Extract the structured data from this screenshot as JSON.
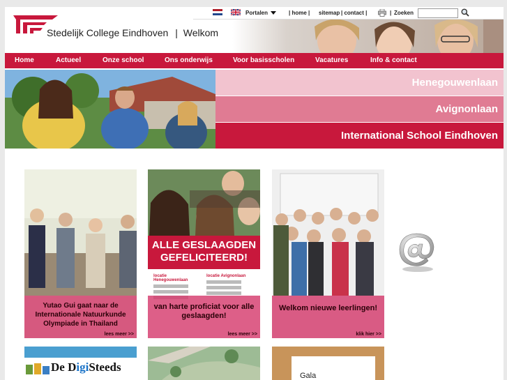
{
  "header": {
    "school_name": "Stedelijk College Eindhoven",
    "separator": "|",
    "welcome": "Welkom"
  },
  "util": {
    "portalen": "Portalen",
    "links": [
      {
        "label": "| home |"
      },
      {
        "label": "sitemap"
      },
      {
        "label": "| contact |"
      },
      {
        "label": "|"
      }
    ],
    "search_label": "Zoeken",
    "search_placeholder": ""
  },
  "nav": {
    "items": [
      {
        "label": "Home"
      },
      {
        "label": "Actueel"
      },
      {
        "label": "Onze school"
      },
      {
        "label": "Ons onderwijs"
      },
      {
        "label": "Voor basisscholen"
      },
      {
        "label": "Vacatures"
      },
      {
        "label": "Info & contact"
      }
    ]
  },
  "locations": [
    {
      "label": "Henegouwenlaan"
    },
    {
      "label": "Avignonlaan"
    },
    {
      "label": "International School Eindhoven"
    }
  ],
  "tiles": [
    {
      "caption": "Yutao Gui gaat naar de Internationale Natuurkunde Olympiade in Thailand",
      "more": "lees meer >>"
    },
    {
      "headline": "ALLE GESLAAGDEN GEFELICITEERD!",
      "loc_a": "locatie Henegouwenlaan",
      "loc_b": "locatie Avignonlaan",
      "caption": "van harte proficiat voor alle geslaagden!",
      "more": "lees meer >>"
    },
    {
      "caption": "Welkom nieuwe leerlingen!",
      "more": "klik hier >>"
    }
  ],
  "bottom_tiles": {
    "digi_pre": "De D",
    "digi_gi": "igi",
    "digi_post": "Steeds",
    "gala": "Gala"
  },
  "colors": {
    "brand": "#c8183c",
    "pink_light": "#f2c3cf",
    "pink_mid": "#e07b93"
  }
}
